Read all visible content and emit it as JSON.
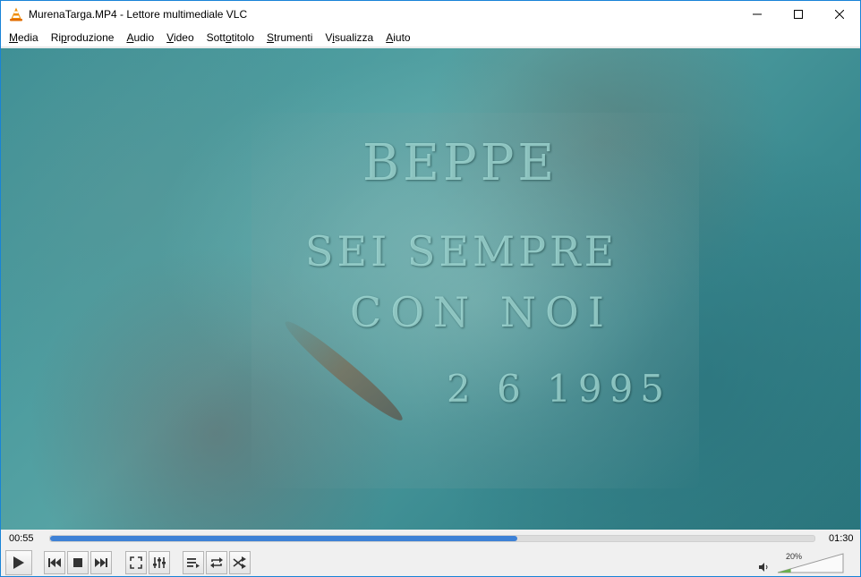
{
  "window": {
    "title": "MurenaTarga.MP4 - Lettore multimediale VLC"
  },
  "menu": [
    {
      "pre": "",
      "key": "M",
      "post": "edia"
    },
    {
      "pre": "Ri",
      "key": "p",
      "post": "roduzione"
    },
    {
      "pre": "",
      "key": "A",
      "post": "udio"
    },
    {
      "pre": "",
      "key": "V",
      "post": "ideo"
    },
    {
      "pre": "Sott",
      "key": "o",
      "post": "titolo"
    },
    {
      "pre": "",
      "key": "S",
      "post": "trumenti"
    },
    {
      "pre": "V",
      "key": "i",
      "post": "sualizza"
    },
    {
      "pre": "",
      "key": "A",
      "post": "iuto"
    }
  ],
  "video": {
    "line1": "BEPPE",
    "line2": "SEI SEMPRE",
    "line3": "CON NOI",
    "line4": "2 6 1995"
  },
  "playback": {
    "elapsed": "00:55",
    "total": "01:30",
    "progress_fraction": 0.611
  },
  "volume": {
    "label": "20%",
    "level_fraction": 0.2
  },
  "icons": {
    "play": "play-icon",
    "prev": "previous-icon",
    "stop": "stop-icon",
    "next": "next-icon",
    "fullscreen": "fullscreen-icon",
    "extended": "extended-settings-icon",
    "playlist": "playlist-icon",
    "loop": "loop-icon",
    "shuffle": "shuffle-icon",
    "volume": "speaker-icon"
  },
  "colors": {
    "accent": "#3d81d6",
    "vlc_orange": "#f08c00",
    "window_border": "#1883d7",
    "volume_green": "#6ab04c"
  }
}
